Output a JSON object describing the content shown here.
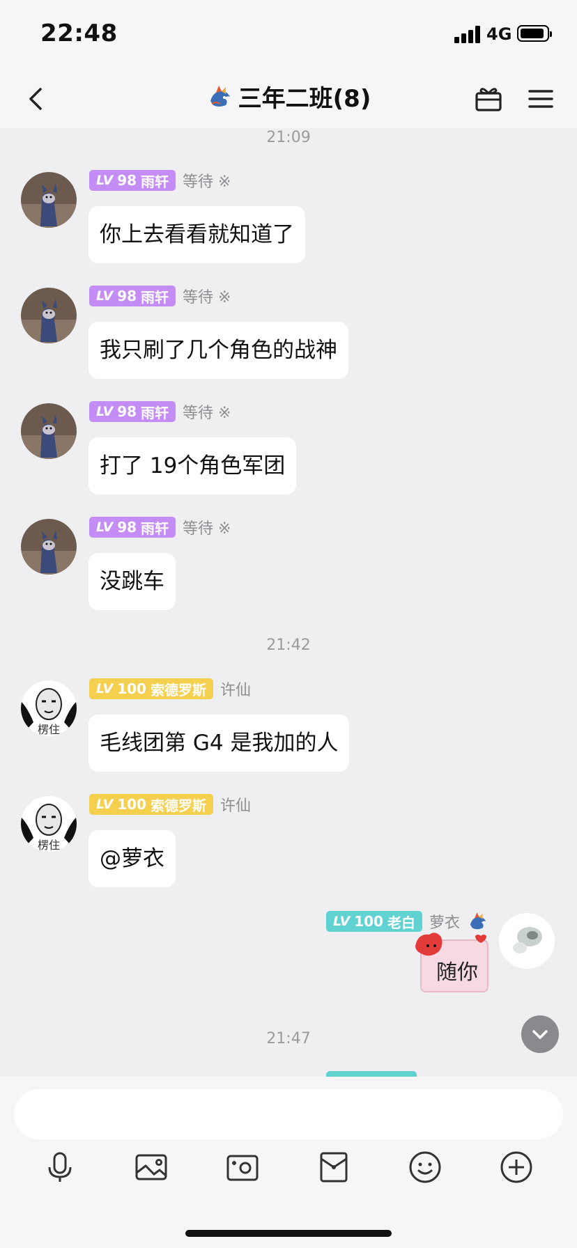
{
  "status": {
    "time": "22:48",
    "network": "4G"
  },
  "header": {
    "title": "三年二班(8)"
  },
  "timestamps": [
    "21:09",
    "21:42",
    "21:47"
  ],
  "messages": [
    {
      "lv": "LV",
      "lv_num": "98",
      "rank": "雨轩",
      "sender": "等待 ※",
      "text": "你上去看看就知道了"
    },
    {
      "lv": "LV",
      "lv_num": "98",
      "rank": "雨轩",
      "sender": "等待 ※",
      "text": "我只刷了几个角色的战神"
    },
    {
      "lv": "LV",
      "lv_num": "98",
      "rank": "雨轩",
      "sender": "等待 ※",
      "text": "打了 19个角色军团"
    },
    {
      "lv": "LV",
      "lv_num": "98",
      "rank": "雨轩",
      "sender": "等待 ※",
      "text": "没跳车"
    },
    {
      "lv": "LV",
      "lv_num": "100",
      "rank": "索德罗斯",
      "sender": "许仙",
      "text": "毛线团第 G4 是我加的人",
      "avatar_caption": "楞住"
    },
    {
      "lv": "LV",
      "lv_num": "100",
      "rank": "索德罗斯",
      "sender": "许仙",
      "text": "@萝衣",
      "avatar_caption": "楞住"
    },
    {
      "lv": "LV",
      "lv_num": "100",
      "rank": "老白",
      "sender": "萝衣",
      "sticker_text": "随你"
    }
  ],
  "colors": {
    "purple_badge": "#c48df5",
    "gold_badge": "#f5cf4e",
    "teal_badge": "#61d2d2",
    "background": "#efeff2"
  },
  "toolbar": {
    "icons": [
      "microphone-icon",
      "image-icon",
      "camera-icon",
      "red-packet-icon",
      "emoji-icon",
      "plus-icon"
    ]
  }
}
